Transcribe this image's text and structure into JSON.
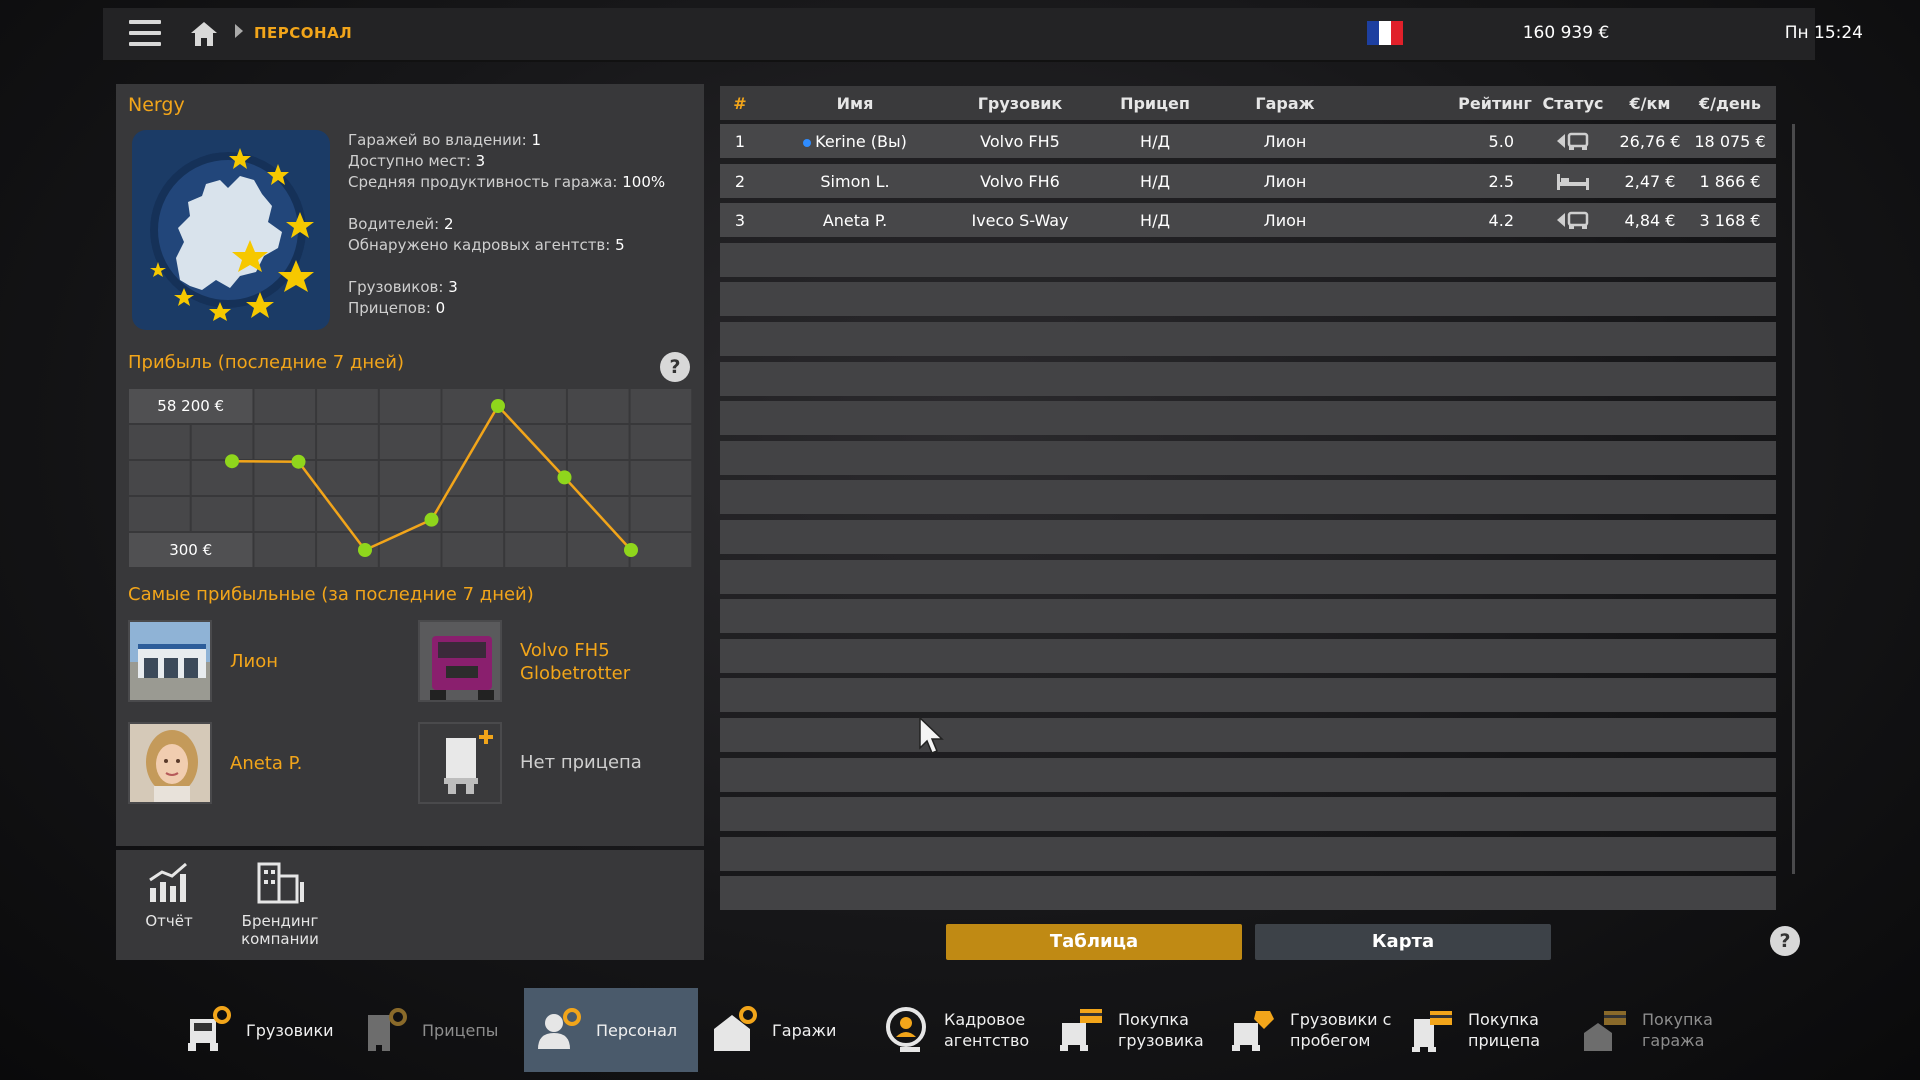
{
  "topbar": {
    "breadcrumb": "ПЕРСОНАЛ",
    "money": "160 939 €",
    "clock": "Пн 15:24",
    "flag_colors": [
      "#1d3fa0",
      "#ffffff",
      "#e1202a"
    ]
  },
  "company": {
    "name": "Nergy",
    "stats": {
      "garages_owned_label": "Гаражей во владении: ",
      "garages_owned": "1",
      "slots_label": "Доступно мест: ",
      "slots": "3",
      "productivity_label": "Средняя продуктивность гаража: ",
      "productivity": "100%",
      "drivers_label": "Водителей: ",
      "drivers": "2",
      "agencies_label": "Обнаружено кадровых агентств: ",
      "agencies": "5",
      "trucks_label": "Грузовиков: ",
      "trucks": "3",
      "trailers_label": "Прицепов: ",
      "trailers": "0"
    }
  },
  "profit": {
    "title": "Прибыль (последние 7 дней)",
    "help": "?"
  },
  "chart_data": {
    "type": "line",
    "title": "Прибыль (последние 7 дней)",
    "tick_labels": [
      "58 200 €",
      "300 €"
    ],
    "ylim": [
      300,
      58200
    ],
    "y": [
      36000,
      35800,
      300,
      12500,
      58200,
      29500,
      300
    ],
    "grid": true,
    "line_color": "#f2a51a",
    "point_color": "#8fd61c"
  },
  "best": {
    "title": "Самые прибыльные (за последние 7 дней)",
    "garage": "Лион",
    "truck_line1": "Volvo FH5",
    "truck_line2": "Globetrotter",
    "driver": "Aneta P.",
    "trailer": "Нет прицепа"
  },
  "tools": {
    "report": "Отчёт",
    "branding_line1": "Брендинг",
    "branding_line2": "компании"
  },
  "table": {
    "headers": [
      "#",
      "Имя",
      "Грузовик",
      "Прицеп",
      "Гараж",
      "Рейтинг",
      "Статус",
      "€/км",
      "€/день"
    ],
    "rows": [
      {
        "num": "1",
        "name": "Kerine (Вы)",
        "truck": "Volvo FH5",
        "trailer": "Н/Д",
        "garage": "Лион",
        "rating": "5.0",
        "status": "driving-icon",
        "per_km": "26,76 €",
        "per_day": "18 075 €"
      },
      {
        "num": "2",
        "name": "Simon L.",
        "truck": "Volvo FH6",
        "trailer": "Н/Д",
        "garage": "Лион",
        "rating": "2.5",
        "status": "bed-icon",
        "per_km": "2,47 €",
        "per_day": "1 866 €"
      },
      {
        "num": "3",
        "name": "Aneta P.",
        "truck": "Iveco S-Way",
        "trailer": "Н/Д",
        "garage": "Лион",
        "rating": "4.2",
        "status": "driving-icon",
        "per_km": "4,84 €",
        "per_day": "3 168 €"
      }
    ]
  },
  "buttons": {
    "table": "Таблица",
    "map": "Карта",
    "help": "?"
  },
  "nav": {
    "trucks": "Грузовики",
    "trailers": "Прицепы",
    "staff": "Персонал",
    "garages": "Гаражи",
    "agency_1": "Кадровое",
    "agency_2": "агентство",
    "buy_truck_1": "Покупка",
    "buy_truck_2": "грузовика",
    "used_1": "Грузовики с",
    "used_2": "пробегом",
    "buy_trailer_1": "Покупка",
    "buy_trailer_2": "прицепа",
    "buy_garage_1": "Покупка",
    "buy_garage_2": "гаража"
  }
}
